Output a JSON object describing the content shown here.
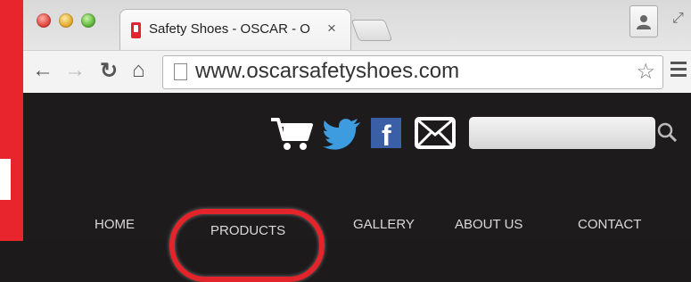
{
  "browser": {
    "tab_title": "Safety Shoes - OSCAR - O",
    "tab_close": "×",
    "url": "www.oscarsafetyshoes.com"
  },
  "site": {
    "nav": {
      "home": "HOME",
      "products": "PRODUCTS",
      "gallery": "GALLERY",
      "about": "ABOUT US",
      "contact": "CONTACT"
    },
    "active_nav": "products",
    "search_placeholder": ""
  },
  "colors": {
    "brand_red": "#e3242b",
    "site_background": "#1d1b1c",
    "twitter_blue": "#3d9be0",
    "facebook_blue": "#3b5fa7"
  },
  "icons": [
    "cart-icon",
    "twitter-icon",
    "facebook-icon",
    "mail-icon",
    "search-icon",
    "back-icon",
    "forward-icon",
    "reload-icon",
    "home-icon",
    "star-icon",
    "menu-icon",
    "profile-icon"
  ]
}
